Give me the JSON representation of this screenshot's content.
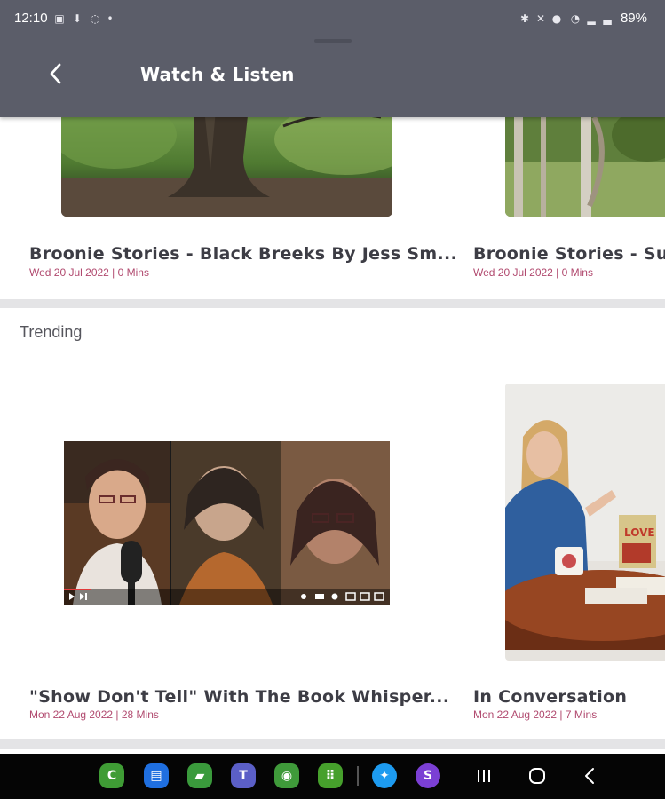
{
  "status_bar": {
    "time": "12:10",
    "battery": "89%"
  },
  "header": {
    "title": "Watch & Listen",
    "back_icon": "chevron-left-icon"
  },
  "row1": {
    "cards": [
      {
        "title": "Broonie Stories - Black Breeks By Jess Sm...",
        "meta": "Wed 20 Jul 2022 | 0 Mins"
      },
      {
        "title": "Broonie Stories - Susy",
        "meta": "Wed 20 Jul 2022 | 0 Mins"
      }
    ]
  },
  "trending": {
    "label": "Trending",
    "cards": [
      {
        "title": "\"Show Don't Tell\" With The Book Whisper...",
        "meta": "Mon 22 Aug 2022 | 28 Mins"
      },
      {
        "title": "In Conversation",
        "meta": "Mon 22 Aug 2022 | 7 Mins"
      }
    ]
  },
  "bottom_nav": {
    "apps": [
      {
        "name": "phone-app",
        "glyph": "C",
        "color": "#3f9c35"
      },
      {
        "name": "messages-app",
        "glyph": "▤",
        "color": "#1f6fe0"
      },
      {
        "name": "notes-app",
        "glyph": "▰",
        "color": "#3a9a3c"
      },
      {
        "name": "teams-app",
        "glyph": "T",
        "color": "#5b5fc7"
      },
      {
        "name": "camera-app",
        "glyph": "◉",
        "color": "#3f9a3a"
      },
      {
        "name": "app-drawer",
        "glyph": "⠿",
        "color": "#46a02c"
      },
      {
        "name": "twitter-app",
        "glyph": "✦",
        "color": "#1d9bf0"
      },
      {
        "name": "shazam-app",
        "glyph": "S",
        "color": "#7b3fd4"
      }
    ]
  }
}
